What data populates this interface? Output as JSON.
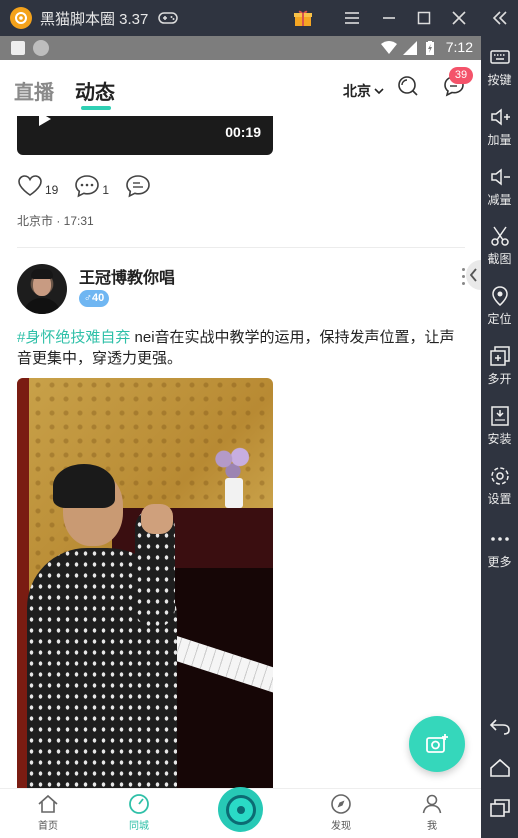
{
  "titlebar": {
    "app_title": "黑猫脚本圈 3.37"
  },
  "sidebar": {
    "items": [
      {
        "label": "按键",
        "icon": "keyboard-icon"
      },
      {
        "label": "加量",
        "icon": "volume-up-icon"
      },
      {
        "label": "减量",
        "icon": "volume-down-icon"
      },
      {
        "label": "截图",
        "icon": "scissors-icon"
      },
      {
        "label": "定位",
        "icon": "location-pin-icon"
      },
      {
        "label": "多开",
        "icon": "multi-open-icon"
      },
      {
        "label": "安装",
        "icon": "apk-install-icon"
      },
      {
        "label": "设置",
        "icon": "gear-icon"
      },
      {
        "label": "更多",
        "icon": "more-dots-icon"
      }
    ]
  },
  "statusbar": {
    "time": "7:12"
  },
  "header": {
    "tabs": [
      {
        "label": "直播",
        "active": false
      },
      {
        "label": "动态",
        "active": true
      }
    ],
    "city": "北京",
    "message_badge": "39",
    "accent_color": "#2fd0b4"
  },
  "previous_post": {
    "video_duration": "00:19",
    "likes": "19",
    "comments": "1",
    "location_time": "北京市 · 17:31"
  },
  "post": {
    "username": "王冠博教你唱",
    "gender_age": "♂40",
    "hashtag": "#身怀绝技难自弃",
    "text": " nei音在实战中教学的运用，保持发声位置，让声音更集中，穿透力更强。"
  },
  "bottom_nav": {
    "items": [
      {
        "label": "首页",
        "icon": "home-icon"
      },
      {
        "label": "同城",
        "icon": "compass-clock-icon",
        "active": true
      },
      {
        "label": "",
        "icon": "center-live-icon"
      },
      {
        "label": "发现",
        "icon": "discover-icon"
      },
      {
        "label": "我",
        "icon": "profile-icon"
      }
    ]
  }
}
